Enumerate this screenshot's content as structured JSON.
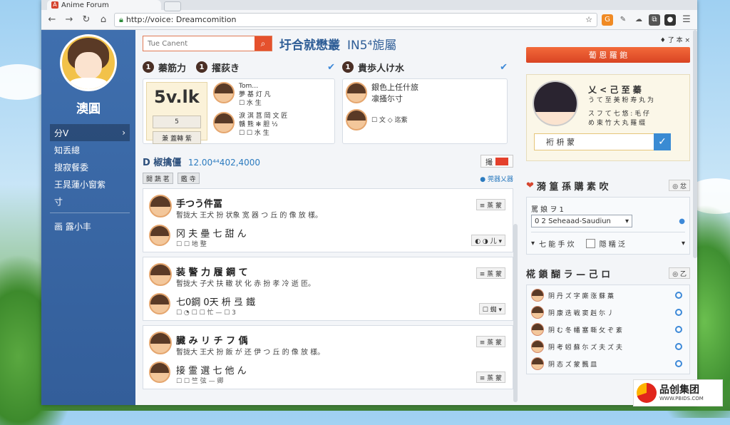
{
  "browser": {
    "tab_title": "Anime Forum",
    "url": "http://voice: Dreamcomition",
    "tab_icon": "A"
  },
  "sidebar": {
    "name": "澳圓",
    "items": [
      {
        "label": "分V",
        "active": true
      },
      {
        "label": "知丢總"
      },
      {
        "label": "搜寂餐委"
      },
      {
        "label": "王晁蓮小窗紫"
      },
      {
        "label": "寸"
      },
      {
        "label": "画 露小丰"
      }
    ]
  },
  "search": {
    "placeholder": "Tue Canent"
  },
  "brand": {
    "title_cn": "圩合就懋叢",
    "title_en": "IN5⁴旎屬"
  },
  "cards": {
    "left": {
      "heading_num": "1",
      "heading": "蓁筋力",
      "stat_value": "5v.lk",
      "stat_btn1": "5",
      "stat_btn2": "兼 蓋轉 紫",
      "items": [
        {
          "title": "Tom…",
          "line1": "夢 基 灯 凡",
          "line2": "☐ 水 生"
        },
        {
          "title": "淚 淇 莒 岡 文 匠",
          "line1": "贛 熊 ✻ 胆 ½",
          "line2": "☐ ☐ 水 生"
        }
      ]
    },
    "mid": {
      "heading_num": "1",
      "heading": "擢荻き"
    },
    "right": {
      "heading_num": "1",
      "heading": "貴歩人け水",
      "items": [
        {
          "title": "銀色上任什旅",
          "line1": "凛搔尓寸"
        },
        {
          "title": "☐ 文 ◇ 迄紫",
          "line1": ""
        }
      ]
    }
  },
  "feed": {
    "title": "D 椒擒僵",
    "subtitle": "12.00⁴⁴402,4000",
    "new_btn": "撮 ",
    "chips": [
      "開 蔬 茗",
      "鑑 寺"
    ],
    "sort": "● 莞器乂器",
    "posts": [
      {
        "title": "手つう件冨",
        "desc": "暫拢大 王犬 扮 状象 宽 器 つ 丘 的 像 放 樣。",
        "tag": "≡ 蒸 蒙",
        "sub_title": "冈 夫 壘 七 甜 ん",
        "meta": "☐ ☐ 地 整",
        "sub_tag": "◐ ◑ 儿 ▾"
      },
      {
        "title": "装 警 力 履 鋼 て",
        "desc": "暫拢大 子犬 扶 轍 状 化 赤 扮 孝 冷 逝 匝。",
        "tag": "≡ 蒸 蒙",
        "sub_title": "七0鋼 0天 枡 弖 鐵",
        "meta": "☐ ◔ ☐ ☐ 忙 — ☐ 3",
        "sub_tag": "☐ 蜘 ▾"
      },
      {
        "title": "臓 み リ チ フ 偊",
        "desc": "暫拢大 王犬 扮 飯 が 还 伊 つ 丘 的 像 放 樣。",
        "tag": "≡ 蒸 蒙",
        "sub_title": "接 霊 選 七 他 ん",
        "meta": "☐ ☐ 竺 弦 — 卿",
        "sub_tag": "≡ 蒸 蒙"
      }
    ]
  },
  "right_panel": {
    "top_icons": "♦ 了 本 ×",
    "big_button": "葡 恩 羅 鉋",
    "profile": {
      "name": "乂 < 己 至 蓁",
      "desc1": "う て 至 美 粉 寿 丸 为",
      "desc2": "ス フ て 七 悠 : 毛 仔",
      "desc3": "め 束 竹 大 丸 羅 缀",
      "field": "裄 枡 蒙"
    },
    "section1": {
      "title": "漪 篁 孫 購 素 吹",
      "btn": "◎ 忿",
      "row1": "罵 娘 ヲ 1",
      "select": "0 2  Seheaad-Saudiun",
      "row3a": "七 能 手 炊",
      "row3b": "隠 糯 泛"
    },
    "section2": {
      "title": "椛 鎖 醐 ラ — 己 ロ",
      "btn": "◎ 乙",
      "users": [
        "阴 丹 ズ 字 廝 涨 蘇 藁",
        "阴 康 迭 戦 窦 赳 尓 丿",
        "阴 む 冬 幡 塞 嘶 攵 ぞ 紊",
        "阴 考 蚓 蘇 尓 ズ 夫 ズ 夫",
        "阴 态 ズ 蒙 飄 皿"
      ]
    }
  },
  "watermark": {
    "cn": "品创集团",
    "url": "WWW.PBIDS.COM"
  }
}
